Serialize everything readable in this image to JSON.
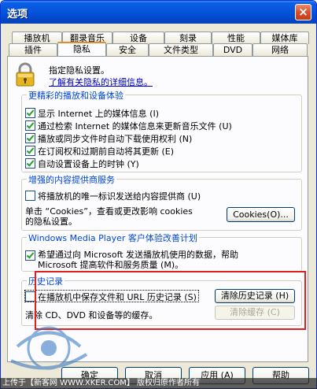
{
  "window": {
    "title": "选项",
    "close_label": "×"
  },
  "tabs": {
    "row1": [
      "播放机",
      "翻录音乐",
      "设备",
      "刻录",
      "性能",
      "媒体库"
    ],
    "row2": [
      "插件",
      "隐私",
      "安全",
      "文件类型",
      "DVD",
      "网络"
    ],
    "active": "隐私"
  },
  "intro": {
    "text": "指定隐私设置。",
    "link": "了解有关隐私的详细信息。"
  },
  "playback_group": {
    "title": "更精彩的播放和设备体验",
    "items": [
      {
        "label": "显示 Internet 上的媒体信息 (I)",
        "checked": true
      },
      {
        "label": "通过检索 Internet 的媒体信息来更新音乐文件 (U)",
        "checked": true
      },
      {
        "label": "播放或同步文件时自动下载使用权利 (N)",
        "checked": true
      },
      {
        "label": "在订阅权和过期前自动将其更新 (E)",
        "checked": true
      },
      {
        "label": "自动设置设备上的时钟 (Y)",
        "checked": true
      }
    ]
  },
  "content_group": {
    "title": "增强的内容提供商服务",
    "checkbox": {
      "label": "将播放机的唯一标识发送给内容提供商 (U)",
      "checked": false
    },
    "text_line1": "单击 “Cookies”，查看或更改影响 cookies",
    "text_line2": "的隐私设置。",
    "cookies_button": "Cookies(O)..."
  },
  "ceip_group": {
    "title": "Windows Media Player 客户体验改善计划",
    "checkbox_line1": "希望通过向 Microsoft 发送播放机使用的数据，帮助",
    "checkbox_line2": "Microsoft 提高软件和服务质量 (M)。",
    "checked": true
  },
  "history_group": {
    "title": "历史记录",
    "checkbox": {
      "label": "在播放机中保存文件和 URL 历史记录 (S)",
      "checked": false
    },
    "clear_history_button": "清除历史记录 (H)",
    "cache_text": "清除 CD、DVD 和设备等的缓存。",
    "clear_cache_button": "清除缓存 (C)"
  },
  "buttons": {
    "ok": "确定",
    "cancel": "取消",
    "apply": "应用 (A)",
    "help": "帮助"
  },
  "footer": "上传于【新客网 WWW.XKER.COM】 版权归原作者所有",
  "colors": {
    "titlebar": "#0553dc",
    "group_title": "#0046d5",
    "highlight_box": "#e02020"
  }
}
